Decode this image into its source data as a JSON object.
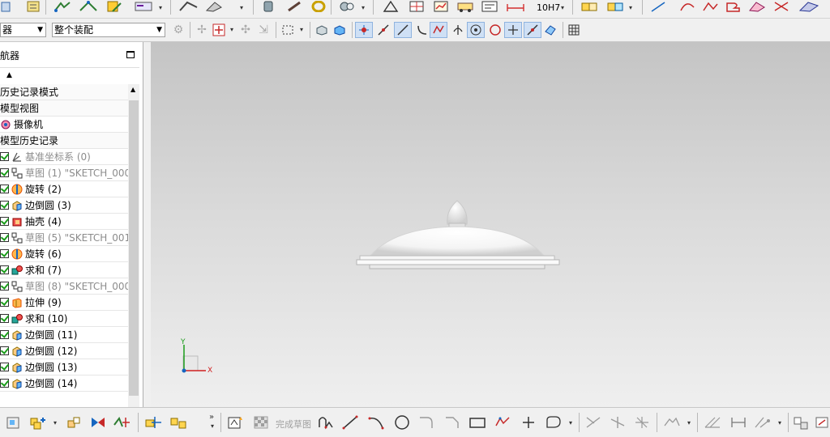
{
  "toolbar_top": {
    "unit_label": "10H7"
  },
  "toolbar_second": {
    "filter_type_value": "器",
    "assembly_scope_value": "整个装配"
  },
  "navigator": {
    "title": "航器",
    "nodes": [
      {
        "label": "历史记录模式",
        "kind": "group"
      },
      {
        "label": "模型视图",
        "kind": "group"
      },
      {
        "label": "摄像机",
        "kind": "camera"
      },
      {
        "label": "模型历史记录",
        "kind": "group"
      },
      {
        "label": "基准坐标系 (0)",
        "kind": "datum",
        "checked": true,
        "muted": true
      },
      {
        "label": "草图 (1) \"SKETCH_000",
        "kind": "sketch",
        "checked": true,
        "muted": true
      },
      {
        "label": "旋转 (2)",
        "kind": "revolve",
        "checked": true
      },
      {
        "label": "边倒圆 (3)",
        "kind": "blend",
        "checked": true
      },
      {
        "label": "抽壳 (4)",
        "kind": "shell",
        "checked": true
      },
      {
        "label": "草图 (5) \"SKETCH_001",
        "kind": "sketch",
        "checked": true,
        "muted": true
      },
      {
        "label": "旋转 (6)",
        "kind": "revolve",
        "checked": true
      },
      {
        "label": "求和 (7)",
        "kind": "unite",
        "checked": true
      },
      {
        "label": "草图 (8) \"SKETCH_000",
        "kind": "sketch",
        "checked": true,
        "muted": true
      },
      {
        "label": "拉伸 (9)",
        "kind": "extrude",
        "checked": true
      },
      {
        "label": "求和 (10)",
        "kind": "unite",
        "checked": true
      },
      {
        "label": "边倒圆 (11)",
        "kind": "blend",
        "checked": true
      },
      {
        "label": "边倒圆 (12)",
        "kind": "blend",
        "checked": true
      },
      {
        "label": "边倒圆 (13)",
        "kind": "blend",
        "checked": true
      },
      {
        "label": "边倒圆 (14)",
        "kind": "blend",
        "checked": true
      }
    ]
  },
  "viewport": {
    "axis_y": "Y",
    "axis_x": "X"
  },
  "toolbar_bottom": {
    "finish_sketch_label": "完成草图"
  },
  "colors": {
    "check": "#1a9c1a",
    "toggle_bg": "#cfe0f5"
  }
}
